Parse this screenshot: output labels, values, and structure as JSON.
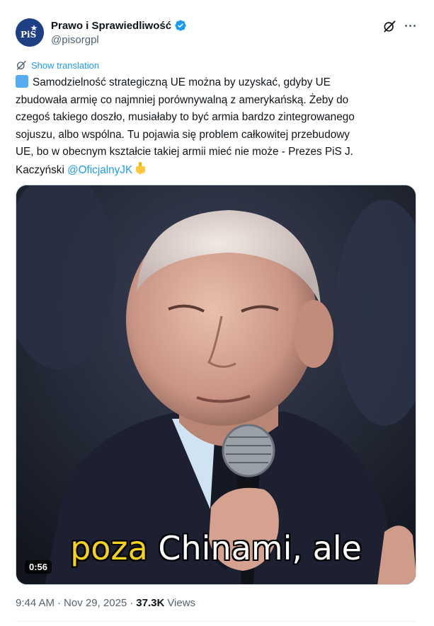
{
  "author": {
    "display_name": "Prawo i Sprawiedliwość",
    "handle": "@pisorgpl",
    "avatar_text": "PiS",
    "verified": true,
    "verified_color": "#1d9bf0"
  },
  "actions": {
    "grok_icon": "grok-icon",
    "more_icon": "more-icon"
  },
  "translation": {
    "label": "Show translation"
  },
  "tweet": {
    "lines": [
      "Samodzielność strategiczną UE można by uzyskać, gdyby UE",
      "zbudowała armię co najmniej porównywalną z amerykańską. Żeby do",
      "czegoś takiego doszło, musiałaby to być armia bardzo zintegrowanego",
      "sojuszu, albo wspólna. Tu pojawia się problem całkowitej przebudowy",
      "UE, bo w obecnym kształcie takiej armii mieć nie może - Prezes PiS J.",
      "Kaczyński"
    ],
    "mention": "@OficjalnyJK",
    "leading_emoji": "blue-square",
    "trailing_emoji": "pointing-down-hand"
  },
  "media": {
    "caption_highlight": "poza",
    "caption_rest": "Chinami, ale",
    "duration": "0:56"
  },
  "meta": {
    "time": "9:44 AM",
    "separator": "·",
    "date": "Nov 29, 2025",
    "views_count": "37.3K",
    "views_label": "Views"
  },
  "colors": {
    "link": "#1d9bf0",
    "text": "#0f1419",
    "secondary": "#536471",
    "caption_yellow": "#f5d21c"
  }
}
